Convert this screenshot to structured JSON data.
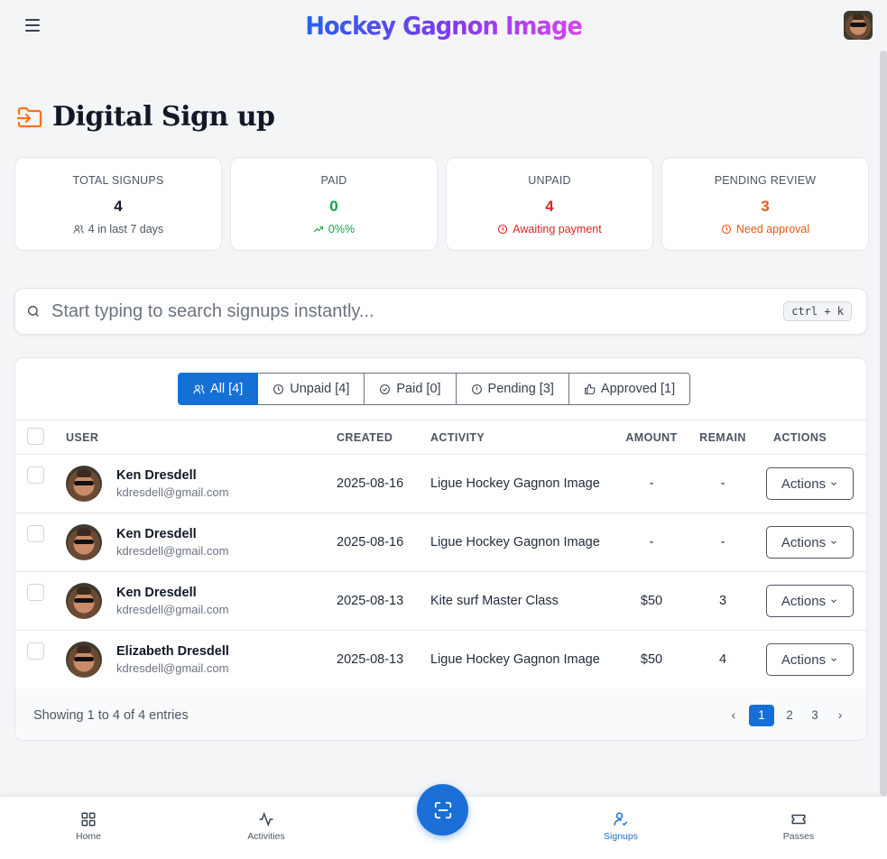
{
  "header": {
    "app_title": "Hockey Gagnon Image",
    "menu_icon": "menu-icon",
    "avatar_icon": "avatar"
  },
  "page": {
    "title": "Digital Sign up",
    "title_icon": "folder-input-icon",
    "title_icon_color": "#f97316"
  },
  "stats": [
    {
      "label": "TOTAL SIGNUPS",
      "value": "4",
      "sub": "4 in last 7 days",
      "icon": "users-icon",
      "value_color": "#111827",
      "sub_color": "#4b5563"
    },
    {
      "label": "PAID",
      "value": "0",
      "sub": "0%%",
      "icon": "trending-up-icon",
      "value_color": "#16a34a",
      "sub_color": "#16a34a"
    },
    {
      "label": "UNPAID",
      "value": "4",
      "sub": "Awaiting payment",
      "icon": "clock-icon",
      "value_color": "#dc2626",
      "sub_color": "#dc2626"
    },
    {
      "label": "PENDING REVIEW",
      "value": "3",
      "sub": "Need approval",
      "icon": "clock-icon",
      "value_color": "#ea580c",
      "sub_color": "#ea580c"
    }
  ],
  "search": {
    "placeholder": "Start typing to search signups instantly...",
    "shortcut": "ctrl + k"
  },
  "tabs": [
    {
      "label": "All [4]",
      "icon": "users-icon",
      "active": true
    },
    {
      "label": "Unpaid [4]",
      "icon": "clock-icon"
    },
    {
      "label": "Paid [0]",
      "icon": "check-circle-icon"
    },
    {
      "label": "Pending [3]",
      "icon": "alert-circle-icon"
    },
    {
      "label": "Approved [1]",
      "icon": "thumbs-up-icon"
    }
  ],
  "table": {
    "columns": {
      "user": "USER",
      "created": "CREATED",
      "activity": "ACTIVITY",
      "amount": "AMOUNT",
      "remain": "REMAIN",
      "actions": "ACTIONS"
    },
    "rows": [
      {
        "name": "Ken Dresdell",
        "email": "kdresdell@gmail.com",
        "created": "2025-08-16",
        "activity": "Ligue Hockey Gagnon Image",
        "amount": "-",
        "remain": "-",
        "action": "Actions"
      },
      {
        "name": "Ken Dresdell",
        "email": "kdresdell@gmail.com",
        "created": "2025-08-16",
        "activity": "Ligue Hockey Gagnon Image",
        "amount": "-",
        "remain": "-",
        "action": "Actions"
      },
      {
        "name": "Ken Dresdell",
        "email": "kdresdell@gmail.com",
        "created": "2025-08-13",
        "activity": "Kite surf Master Class",
        "amount": "$50",
        "remain": "3",
        "action": "Actions"
      },
      {
        "name": "Elizabeth Dresdell",
        "email": "kdresdell@gmail.com",
        "created": "2025-08-13",
        "activity": "Ligue Hockey Gagnon Image",
        "amount": "$50",
        "remain": "4",
        "action": "Actions"
      }
    ]
  },
  "footer": {
    "info": "Showing 1 to 4 of 4 entries",
    "pages": [
      "1",
      "2",
      "3"
    ],
    "prev": "‹",
    "next": "›"
  },
  "bottom_nav": [
    {
      "label": "Home",
      "icon": "home-grid-icon"
    },
    {
      "label": "Activities",
      "icon": "activity-icon"
    },
    {
      "label": "Signups",
      "icon": "user-check-icon",
      "active": true
    },
    {
      "label": "Passes",
      "icon": "ticket-icon"
    }
  ],
  "fab_icon": "scan-icon",
  "accent_color": "#1570d6"
}
